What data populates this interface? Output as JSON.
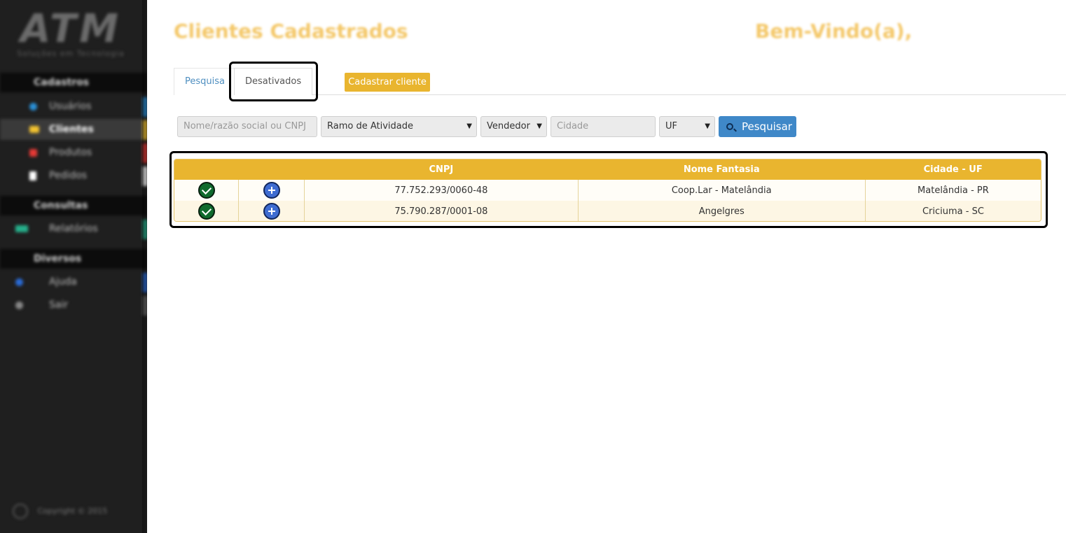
{
  "sidebar": {
    "logo_text": "ATM",
    "logo_subtitle": "Soluções em Tecnologia",
    "sections": {
      "cadastros": "Cadastros",
      "consultas": "Consultas",
      "diversos": "Diversos"
    },
    "items": [
      {
        "label": "Usuários",
        "color": "#2a8fd6"
      },
      {
        "label": "Clientes",
        "color": "#f2c230"
      },
      {
        "label": "Produtos",
        "color": "#e53935"
      },
      {
        "label": "Pedidos",
        "color": "#ffffff"
      },
      {
        "label": "Relatórios",
        "color": "#26b08c"
      },
      {
        "label": "Ajuda",
        "color": "#2a6bd6"
      },
      {
        "label": "Sair",
        "color": "#888888"
      }
    ],
    "copyright": "Copyright © 2015"
  },
  "header": {
    "title": "Clientes Cadastrados",
    "welcome": "Bem-Vindo(a),"
  },
  "tabs": {
    "pesquisa": "Pesquisa",
    "desativados": "Desativados"
  },
  "actions": {
    "cadastrar": "Cadastrar cliente",
    "pesquisar": "Pesquisar"
  },
  "filters": {
    "nome_placeholder": "Nome/razão social ou CNPJ",
    "ramo": "Ramo de Atividade",
    "vendedor": "Vendedor",
    "cidade_placeholder": "Cidade",
    "uf": "UF"
  },
  "table": {
    "headers": [
      "",
      "",
      "CNPJ",
      "Nome Fantasia",
      "Cidade - UF"
    ],
    "rows": [
      {
        "cnpj": "77.752.293/0060-48",
        "nome": "Coop.Lar - Matelândia",
        "cidade": "Matelândia - PR"
      },
      {
        "cnpj": "75.790.287/0001-08",
        "nome": "Angelgres",
        "cidade": "Criciuma - SC"
      }
    ]
  },
  "colors": {
    "accent": "#e9b52f",
    "primary_button": "#3f88c8",
    "sidebar_bg": "#1f1f1f"
  }
}
